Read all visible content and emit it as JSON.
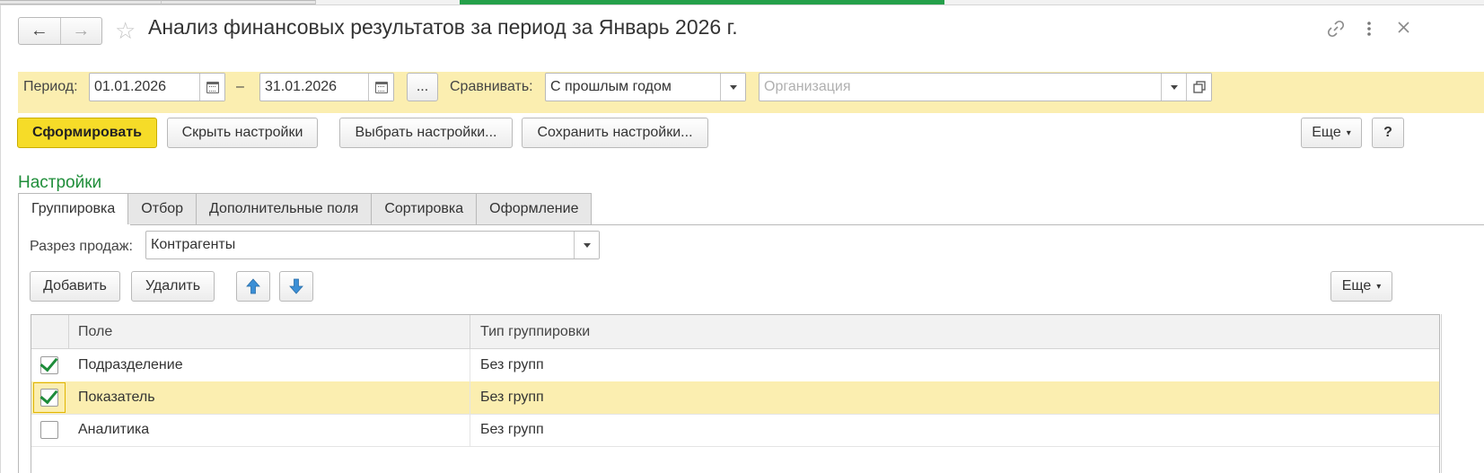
{
  "window": {
    "title": "Анализ финансовых результатов за период за Январь 2026 г."
  },
  "filters": {
    "period_label": "Период:",
    "date_from": "01.01.2026",
    "dash": "–",
    "date_to": "31.01.2026",
    "more_button": "...",
    "compare_label": "Сравнивать:",
    "compare_value": "С прошлым годом",
    "organization_placeholder": "Организация"
  },
  "toolbar": {
    "generate": "Сформировать",
    "hide_settings": "Скрыть настройки",
    "choose_settings": "Выбрать настройки...",
    "save_settings": "Сохранить настройки...",
    "more": "Еще",
    "help": "?"
  },
  "settings": {
    "title": "Настройки",
    "tabs": [
      {
        "label": "Группировка",
        "active": true
      },
      {
        "label": "Отбор",
        "active": false
      },
      {
        "label": "Дополнительные поля",
        "active": false
      },
      {
        "label": "Сортировка",
        "active": false
      },
      {
        "label": "Оформление",
        "active": false
      }
    ],
    "sales_section_label": "Разрез продаж:",
    "sales_section_value": "Контрагенты",
    "add": "Добавить",
    "delete": "Удалить",
    "more": "Еще",
    "grid": {
      "columns": [
        "Поле",
        "Тип группировки"
      ],
      "rows": [
        {
          "checked": true,
          "field": "Подразделение",
          "type": "Без групп",
          "selected": false
        },
        {
          "checked": true,
          "field": "Показатель",
          "type": "Без групп",
          "selected": true
        },
        {
          "checked": false,
          "field": "Аналитика",
          "type": "Без групп",
          "selected": false
        }
      ]
    }
  },
  "colors": {
    "accent_yellow": "#f6dc28",
    "filter_bar": "#fbeeb0",
    "settings_green": "#1f8e3a",
    "active_tab_strip": "#25a04a",
    "arrow_blue": "#3b8fd6"
  }
}
